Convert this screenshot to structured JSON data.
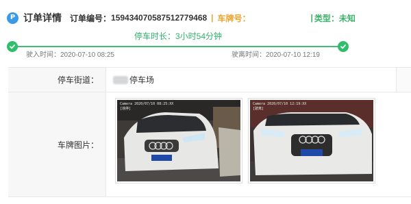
{
  "header": {
    "icon": "parking-p-icon",
    "icon_glyph": "P",
    "title": "订单详情",
    "order_label": "订单编号：",
    "order_no": "15943407058751277946​8",
    "sep1": "|",
    "plate_label": "车牌号：",
    "sep2": "|",
    "type_label": "类型：未知"
  },
  "timeline": {
    "duration": "停车时长：3小时54分钟",
    "enter": "驶入时间：2020-07-10 08:25",
    "leave": "驶离时间：2020-07-10 12:19"
  },
  "details": {
    "street_label": "停车街道：",
    "street_value": "停车场",
    "photo_label": "车牌图片："
  },
  "photos": [
    {
      "stamp1": "Camera  2020/07/10  08:25:XX",
      "stamp2": "[违停]"
    },
    {
      "stamp1": "Camera  2020/07/10  12:19:XX",
      "stamp2": "[驶离]"
    }
  ],
  "colors": {
    "accent_green": "#2fbf6b",
    "plate_orange": "#f1a22b",
    "icon_blue": "#3a9ae8"
  }
}
